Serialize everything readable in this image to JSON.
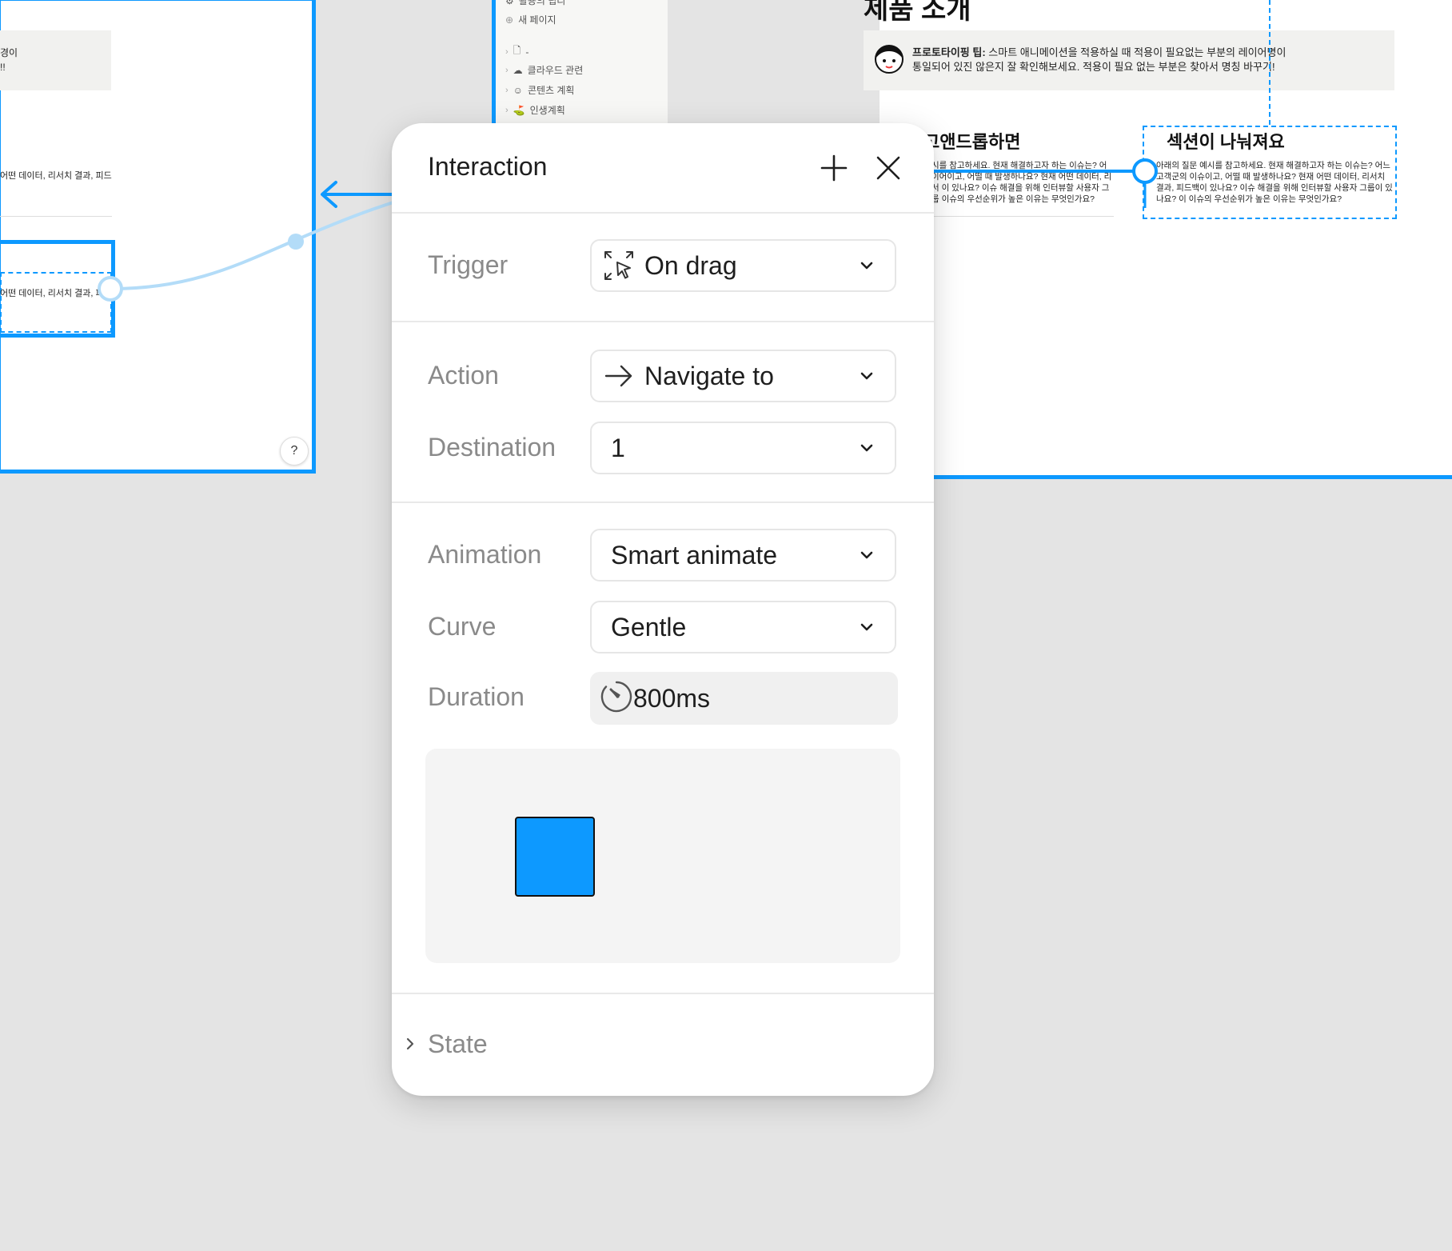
{
  "canvas": {
    "left_frame": {
      "snippet_top_1": "경이",
      "snippet_top_2": "!!",
      "snippet_mid": "어떤 데이터, 리서치 결과, 피드",
      "snippet_box": "어떤 데이터, 리서치 결과, 피",
      "help_label": "?"
    },
    "sidebar": {
      "items": [
        {
          "icon": "gear-icon",
          "label": "활용의 팁리"
        },
        {
          "icon": "plus-circle-icon",
          "label": "새 페이지"
        },
        {
          "icon": "page-icon",
          "label": "-"
        },
        {
          "icon": "cloud-icon",
          "label": "클라우드 관련"
        },
        {
          "icon": "avatar-icon",
          "label": "콘텐츠 계획"
        },
        {
          "icon": "golf-icon",
          "label": "인생계획"
        }
      ]
    },
    "right_frame": {
      "heading": "제품 소개",
      "tip_bold": "프로토타이핑 팁:",
      "tip_line1": " 스마트 애니메이션을 적용하실 때 적용이 필요없는 부분의 레이어명이",
      "tip_line2": "통일되어 있진 않은지 잘 확인해보세요. 적용이 필요 없는 부분은 찾아서 명칭 바꾸기!",
      "section_a_title": "고앤드롭하면",
      "section_a_body": "시를 참고하세요. 현재 해결하고자 하는 이슈는? 어 이어이고, 어떨 때 발생하나요? 현재 어떤 데이터, 리서 이 있나요? 이슈 해결을 위해 인터뷰할 사용자 그룹 이슈의 우선순위가 높은 이유는 무엇인가요?",
      "section_b_title": "섹션이 나눠져요",
      "section_b_body": "아래의 질문 예시를 참고하세요. 현재 해결하고자 하는 이슈는? 어느 고객군의 이슈이고, 어떨 때 발생하나요? 현재 어떤 데이터, 리서치 결과, 피드백이 있나요? 이슈 해결을 위해 인터뷰할 사용자 그룹이 있나요? 이 이슈의 우선순위가 높은 이유는 무엇인가요?"
    }
  },
  "panel": {
    "title": "Interaction",
    "add_icon": "plus-icon",
    "close_icon": "close-icon",
    "trigger": {
      "label": "Trigger",
      "value": "On drag",
      "icon": "drag-cursor-icon"
    },
    "action": {
      "label": "Action",
      "value": "Navigate to",
      "icon": "arrow-right-icon"
    },
    "destination": {
      "label": "Destination",
      "value": "1"
    },
    "animation": {
      "label": "Animation",
      "value": "Smart animate"
    },
    "curve": {
      "label": "Curve",
      "value": "Gentle"
    },
    "duration": {
      "label": "Duration",
      "value": "800ms",
      "icon": "timer-icon"
    },
    "state": {
      "label": "State"
    }
  },
  "colors": {
    "accent": "#0d99ff",
    "connector": "#b3dcf8",
    "canvas_bg": "#e4e4e4",
    "panel_bg": "#ffffff",
    "label_gray": "#8a8a8a"
  }
}
